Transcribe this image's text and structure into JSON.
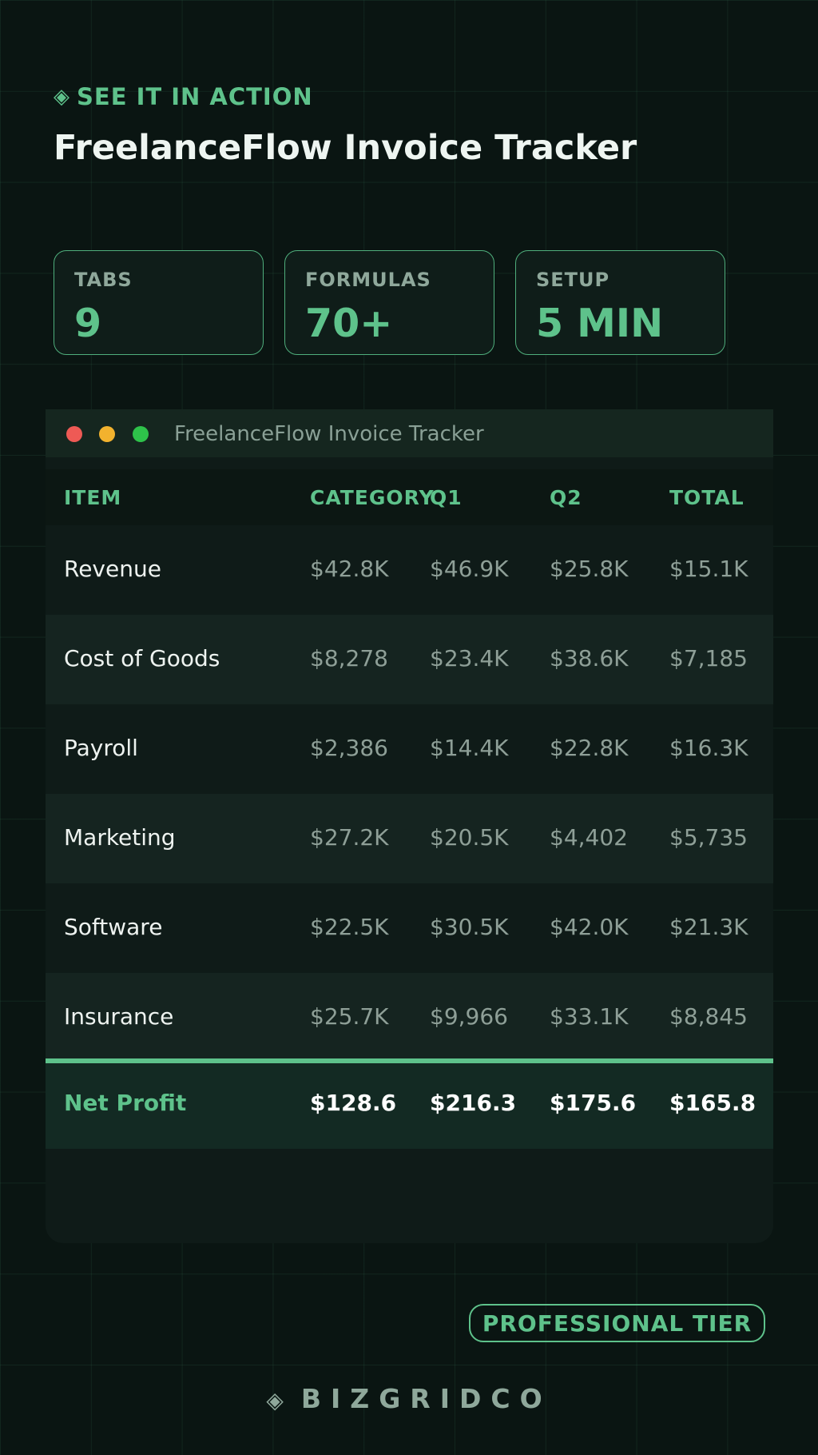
{
  "header": {
    "eyebrow_icon": "◈",
    "eyebrow": "SEE IT IN ACTION",
    "title": "FreelanceFlow Invoice Tracker"
  },
  "stats": [
    {
      "label": "TABS",
      "value": "9"
    },
    {
      "label": "FORMULAS",
      "value": "70+"
    },
    {
      "label": "SETUP",
      "value": "5 MIN"
    }
  ],
  "window": {
    "title": "FreelanceFlow Invoice Tracker",
    "columns": [
      "ITEM",
      "CATEGORY",
      "Q1",
      "Q2",
      "TOTAL"
    ],
    "rows": [
      {
        "item": "Revenue",
        "values": [
          "$42.8K",
          "$46.9K",
          "$25.8K",
          "$15.1K"
        ]
      },
      {
        "item": "Cost of Goods",
        "values": [
          "$8,278",
          "$23.4K",
          "$38.6K",
          "$7,185"
        ]
      },
      {
        "item": "Payroll",
        "values": [
          "$2,386",
          "$14.4K",
          "$22.8K",
          "$16.3K"
        ]
      },
      {
        "item": "Marketing",
        "values": [
          "$27.2K",
          "$20.5K",
          "$4,402",
          "$5,735"
        ]
      },
      {
        "item": "Software",
        "values": [
          "$22.5K",
          "$30.5K",
          "$42.0K",
          "$21.3K"
        ]
      },
      {
        "item": "Insurance",
        "values": [
          "$25.7K",
          "$9,966",
          "$33.1K",
          "$8,845"
        ]
      }
    ],
    "total": {
      "item": "Net Profit",
      "values": [
        "$128.6",
        "$216.3",
        "$175.6",
        "$165.8"
      ]
    }
  },
  "badge": "PROFESSIONAL TIER",
  "brand": {
    "icon": "◈",
    "name": "BIZGRIDCO"
  },
  "colors": {
    "accent": "#5ec28b",
    "background": "#0a1512",
    "dot_red": "#ee5a55",
    "dot_yellow": "#f2b22e",
    "dot_green": "#2ec24a"
  }
}
